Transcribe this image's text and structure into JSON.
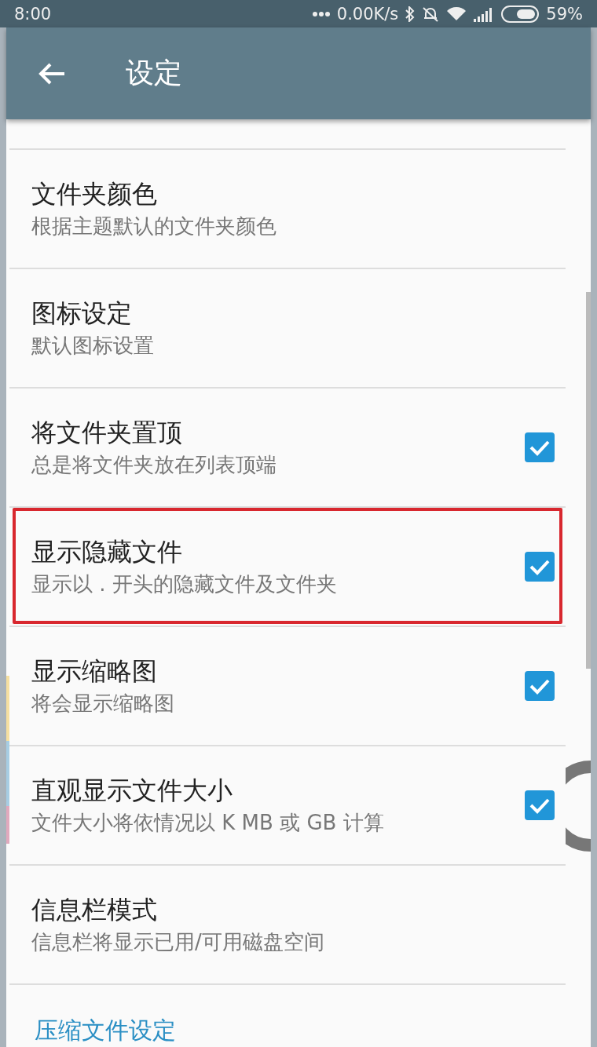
{
  "status_bar": {
    "time": "8:00",
    "network_speed": "0.00K/s",
    "battery": "59%"
  },
  "app_bar": {
    "title": "设定"
  },
  "settings": [
    {
      "title": "文件夹颜色",
      "subtitle": "根据主题默认的文件夹颜色",
      "kind": "plain",
      "highlighted": false
    },
    {
      "title": "图标设定",
      "subtitle": "默认图标设置",
      "kind": "plain",
      "highlighted": false
    },
    {
      "title": "将文件夹置顶",
      "subtitle": "总是将文件夹放在列表顶端",
      "kind": "checkbox",
      "checked": true,
      "highlighted": false
    },
    {
      "title": "显示隐藏文件",
      "subtitle": "显示以 . 开头的隐藏文件及文件夹",
      "kind": "checkbox",
      "checked": true,
      "highlighted": true
    },
    {
      "title": "显示缩略图",
      "subtitle": "将会显示缩略图",
      "kind": "checkbox",
      "checked": true,
      "highlighted": false
    },
    {
      "title": "直观显示文件大小",
      "subtitle": "文件大小将依情况以 K MB 或 GB 计算",
      "kind": "checkbox",
      "checked": true,
      "highlighted": false
    },
    {
      "title": "信息栏模式",
      "subtitle": "信息栏将显示已用/可用磁盘空间",
      "kind": "plain",
      "highlighted": false
    }
  ],
  "section_header": "压缩文件设定"
}
